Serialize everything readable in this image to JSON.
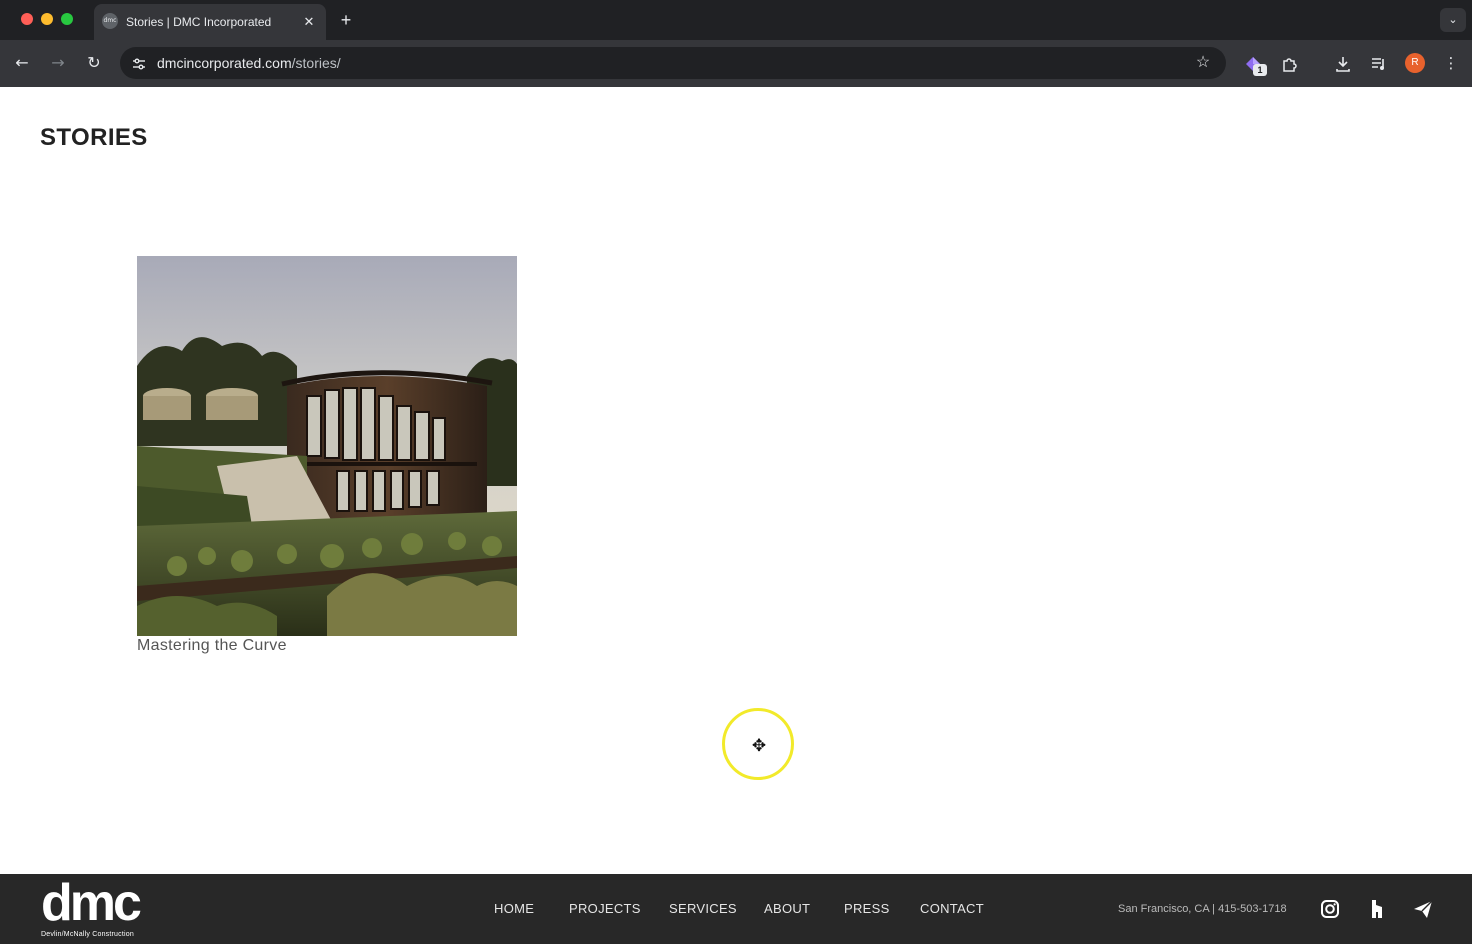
{
  "browser": {
    "tab": {
      "favicon": "dmc",
      "title": "Stories | DMC Incorporated",
      "close_glyph": "✕"
    },
    "new_tab_glyph": "+",
    "tab_search_glyph": "⌄",
    "nav": {
      "back": "←",
      "forward": "→",
      "reload": "↻"
    },
    "url": {
      "domain": "dmcincorporated.com",
      "path": "/stories/"
    },
    "extension_badge": "1",
    "avatar_letter": "R",
    "icons": [
      "site-info-icon",
      "star-icon",
      "extension-diamond-icon",
      "puzzle-icon",
      "download-icon",
      "media-icon",
      "menu-icon"
    ]
  },
  "page": {
    "title": "STORIES",
    "stories": [
      {
        "caption": "Mastering the Curve",
        "image_description": "curved wood house on a hillside garden at sunset"
      }
    ]
  },
  "cursor": {
    "glyph": "✥"
  },
  "footer": {
    "logo_text": "dmc",
    "logo_subtext": "Devlin/McNally Construction",
    "nav": [
      "HOME",
      "PROJECTS",
      "SERVICES",
      "ABOUT",
      "PRESS",
      "CONTACT"
    ],
    "contact_info": "San Francisco, CA | 415-503-1718",
    "social_icons": [
      "instagram-icon",
      "houzz-icon",
      "paper-plane-icon"
    ]
  },
  "colors": {
    "chrome_dark": "#202124",
    "chrome_toolbar": "#35363a",
    "footer_bg": "#282828",
    "title_text": "#222222",
    "caption_text": "#555555",
    "cursor_ring": "#f2ea2a",
    "avatar": "#e8622d"
  }
}
